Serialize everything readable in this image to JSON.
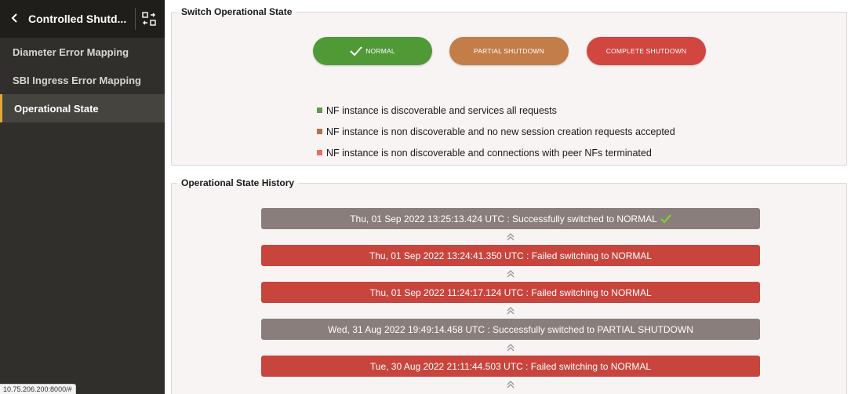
{
  "sidebar": {
    "back_icon": "chevron-left-icon",
    "title": "Controlled Shutd...",
    "toggle_icon": "collapse-panel-icon",
    "items": [
      {
        "label": "Diameter Error Mapping",
        "active": false
      },
      {
        "label": "SBI Ingress Error Mapping",
        "active": false
      },
      {
        "label": "Operational State",
        "active": true
      }
    ]
  },
  "switch_panel": {
    "title": "Switch Operational State",
    "buttons": {
      "normal": "NORMAL",
      "partial": "PARTIAL SHUTDOWN",
      "complete": "COMPLETE SHUTDOWN"
    },
    "selected": "NORMAL",
    "legend": [
      {
        "color": "#5c9d45",
        "text": "NF instance is discoverable and services all requests"
      },
      {
        "color": "#b0754a",
        "text": "NF instance is non discoverable and no new session creation requests accepted"
      },
      {
        "color": "#ec6b64",
        "text": "NF instance is non discoverable and connections with peer NFs terminated"
      }
    ]
  },
  "history_panel": {
    "title": "Operational State History",
    "entries": [
      {
        "text": "Thu, 01 Sep 2022 13:25:13.424 UTC : Successfully switched to NORMAL",
        "status": "success",
        "check": true
      },
      {
        "text": "Thu, 01 Sep 2022 13:24:41.350 UTC : Failed switching to NORMAL",
        "status": "failed",
        "check": false
      },
      {
        "text": "Thu, 01 Sep 2022 11:24:17.124 UTC : Failed switching to NORMAL",
        "status": "failed",
        "check": false
      },
      {
        "text": "Wed, 31 Aug 2022 19:49:14.458 UTC : Successfully switched to PARTIAL SHUTDOWN",
        "status": "success",
        "check": false
      },
      {
        "text": "Tue, 30 Aug 2022 21:11:44.503 UTC : Failed switching to NORMAL",
        "status": "failed",
        "check": false
      }
    ]
  },
  "status_bar": {
    "url": "10.75.206.200:8000/#"
  },
  "colors": {
    "accent": "#e2a63f",
    "normal": "#4f9a37",
    "partial": "#c37d48",
    "complete": "#d1463f",
    "history_success": "#8a7e7c",
    "history_failed": "#c8453d",
    "check_green": "#7fcf2e"
  }
}
